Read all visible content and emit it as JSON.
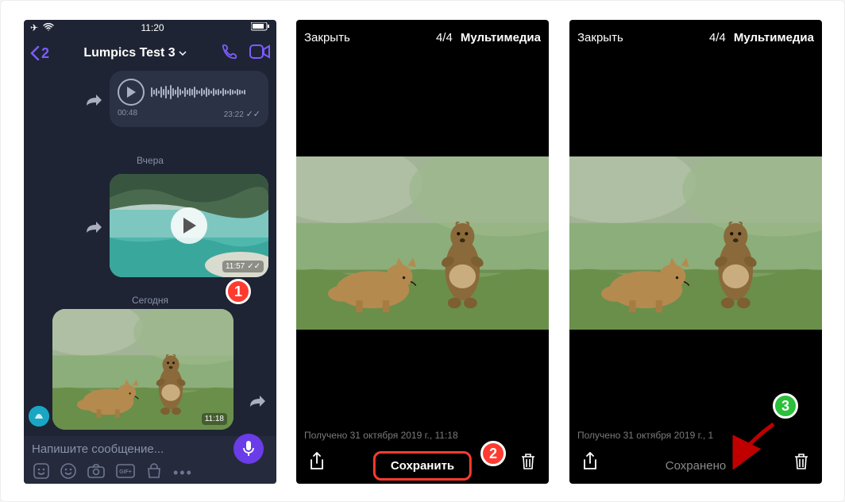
{
  "status": {
    "time": "11:20"
  },
  "chat": {
    "back_count": "2",
    "title": "Lumpics Test 3",
    "audio": {
      "pos": "00:48",
      "dur": "23:22"
    },
    "date1": "Вчера",
    "video_time": "11:57",
    "date2": "Сегодня",
    "photo_time": "11:18",
    "placeholder": "Напишите сообщение..."
  },
  "viewer": {
    "close": "Закрыть",
    "count": "4/4",
    "multimedia": "Мультимедиа",
    "meta": "Получено 31 октября 2019 г., 11:18",
    "meta_cut": "Получено 31 октября 2019 г., 1",
    "save": "Сохранить",
    "saved": "Сохранено"
  },
  "steps": {
    "s1": "1",
    "s2": "2",
    "s3": "3"
  }
}
